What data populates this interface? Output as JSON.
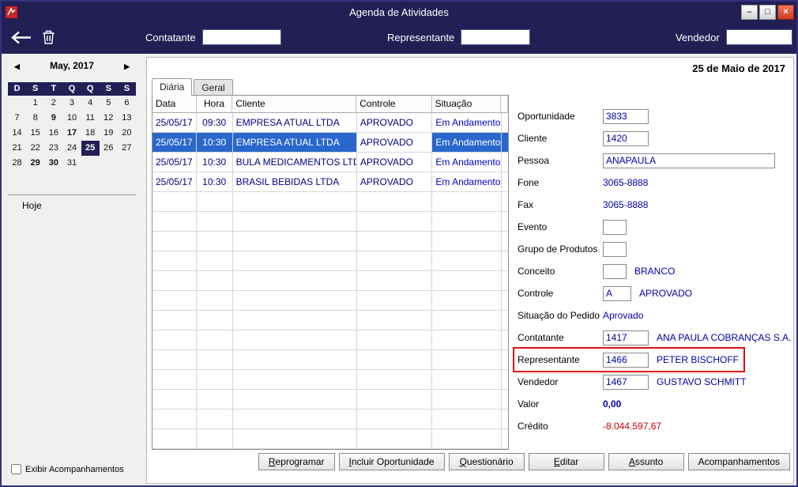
{
  "window": {
    "title": "Agenda de Atividades",
    "controls": {
      "minimize": "–",
      "maximize": "□",
      "close": "×"
    }
  },
  "toolbar": {
    "fields": [
      {
        "label": "Contatante",
        "value": ""
      },
      {
        "label": "Representante",
        "value": ""
      },
      {
        "label": "Vendedor",
        "value": ""
      }
    ]
  },
  "calendar": {
    "prev_arrow": "◀",
    "next_arrow": "▶",
    "month_label": "May, 2017",
    "day_headers": [
      "D",
      "S",
      "T",
      "Q",
      "Q",
      "S",
      "S"
    ],
    "weeks": [
      [
        "",
        "1",
        "2",
        "3",
        "4",
        "5",
        "6"
      ],
      [
        "7",
        "8",
        "9",
        "10",
        "11",
        "12",
        "13"
      ],
      [
        "14",
        "15",
        "16",
        "17",
        "18",
        "19",
        "20"
      ],
      [
        "21",
        "22",
        "23",
        "24",
        "25",
        "26",
        "27"
      ],
      [
        "28",
        "29",
        "30",
        "31",
        "",
        "",
        ""
      ]
    ],
    "bold_days": [
      9,
      17,
      29,
      30
    ],
    "selected_day": 25,
    "today_label": "Hoje"
  },
  "footer": {
    "checkbox_label": "Exibir Acompanhamentos",
    "checked": false
  },
  "main": {
    "date_header": "25 de Maio de 2017",
    "tabs": [
      {
        "label": "Diária",
        "active": true
      },
      {
        "label": "Geral",
        "active": false
      }
    ],
    "table": {
      "columns": [
        "Data",
        "Hora",
        "Cliente",
        "Controle",
        "Situação"
      ],
      "rows": [
        [
          "25/05/17",
          "09:30",
          "EMPRESA ATUAL LTDA",
          "APROVADO",
          "Em Andamento"
        ],
        [
          "25/05/17",
          "10:30",
          "EMPRESA ATUAL LTDA",
          "APROVADO",
          "Em Andamento"
        ],
        [
          "25/05/17",
          "10:30",
          "BULA MEDICAMENTOS LTDA",
          "APROVADO",
          "Em Andamento"
        ],
        [
          "25/05/17",
          "10:30",
          "BRASIL BEBIDAS LTDA",
          "APROVADO",
          "Em Andamento"
        ]
      ],
      "selected_row_index": 1,
      "empty_row_count": 13
    },
    "form": {
      "fields": [
        {
          "label": "Oportunidade",
          "input": "3833",
          "size": "sm"
        },
        {
          "label": "Cliente",
          "input": "1420",
          "size": "sm"
        },
        {
          "label": "Pessoa",
          "input": "ANAPAULA",
          "size": "wide"
        },
        {
          "label": "Fone",
          "text": "3065-8888"
        },
        {
          "label": "Fax",
          "text": "3065-8888"
        },
        {
          "label": "Evento",
          "input": "",
          "size": "xs"
        },
        {
          "label": "Grupo de Produtos",
          "input": "",
          "size": "xs"
        },
        {
          "label": "Conceito",
          "input": "",
          "size": "xs",
          "text": "BRANCO"
        },
        {
          "label": "Controle",
          "input": "A",
          "size": "md",
          "text": "APROVADO"
        },
        {
          "label": "Situação do Pedido",
          "text": "Aprovado"
        },
        {
          "label": "Contatante",
          "input": "1417",
          "size": "sm",
          "text": "ANA PAULA COBRANÇAS S.A."
        },
        {
          "label": "Representante",
          "input": "1466",
          "size": "sm",
          "text": "PETER BISCHOFF",
          "highlighted": true
        },
        {
          "label": "Vendedor",
          "input": "1467",
          "size": "sm",
          "text": "GUSTAVO SCHMITT"
        },
        {
          "label": "Valor",
          "text": "0,00",
          "bold": true
        },
        {
          "label": "Crédito",
          "text": "-8.044.597,67",
          "red": true
        }
      ]
    },
    "buttons": [
      {
        "label": "Reprogramar",
        "mnemonic": true
      },
      {
        "label": "Incluir Oportunidade",
        "mnemonic": true
      },
      {
        "label": "Questionário",
        "mnemonic": true
      },
      {
        "label": "Editar",
        "mnemonic": true
      },
      {
        "label": "Assunto",
        "mnemonic": true
      },
      {
        "label": "Acompanhamentos",
        "mnemonic": false
      }
    ]
  },
  "colors": {
    "titlebar": "#221f55",
    "selection": "#2a67cd",
    "value_blue": "#0000a8",
    "status_blue": "#0000cd",
    "negative_red": "#cc0000",
    "highlight_red": "#dd1111"
  }
}
